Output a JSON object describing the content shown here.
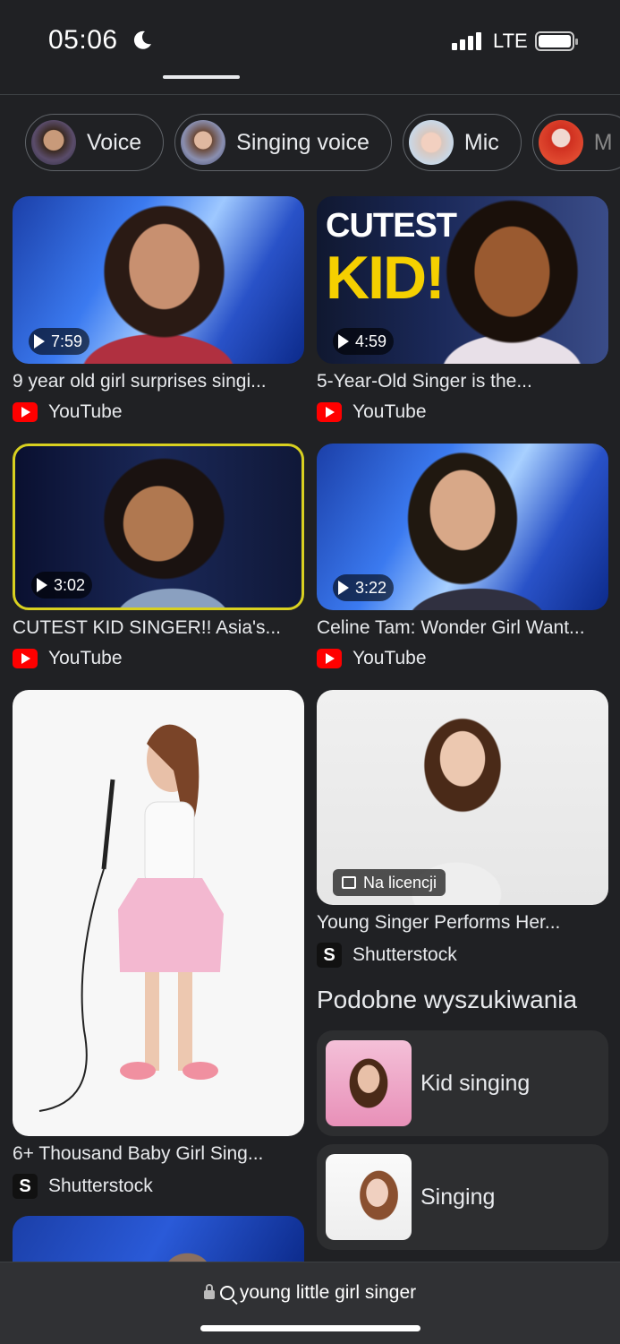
{
  "status_bar": {
    "time": "05:06",
    "network": "LTE"
  },
  "chips": [
    {
      "label": "Voice"
    },
    {
      "label": "Singing voice"
    },
    {
      "label": "Mic"
    },
    {
      "label": "M"
    }
  ],
  "results": [
    {
      "title": "9 year old girl surprises singi...",
      "source": "YouTube",
      "duration": "7:59"
    },
    {
      "title": "5-Year-Old Singer is the...",
      "source": "YouTube",
      "duration": "4:59"
    },
    {
      "title": "CUTEST KID SINGER!! Asia's...",
      "source": "YouTube",
      "duration": "3:02"
    },
    {
      "title": "Celine Tam: Wonder Girl Want...",
      "source": "YouTube",
      "duration": "3:22"
    },
    {
      "title": "6+ Thousand Baby Girl Sing...",
      "source": "Shutterstock"
    },
    {
      "title": "Young Singer Performs Her...",
      "source": "Shutterstock",
      "badge": "Na licencji"
    }
  ],
  "thumb_text": {
    "cutest": "CUTEST",
    "kid": "KID!"
  },
  "related": {
    "heading": "Podobne wyszukiwania",
    "items": [
      {
        "label": "Kid singing"
      },
      {
        "label": "Singing"
      }
    ]
  },
  "address_bar": {
    "query": "young little girl singer"
  }
}
